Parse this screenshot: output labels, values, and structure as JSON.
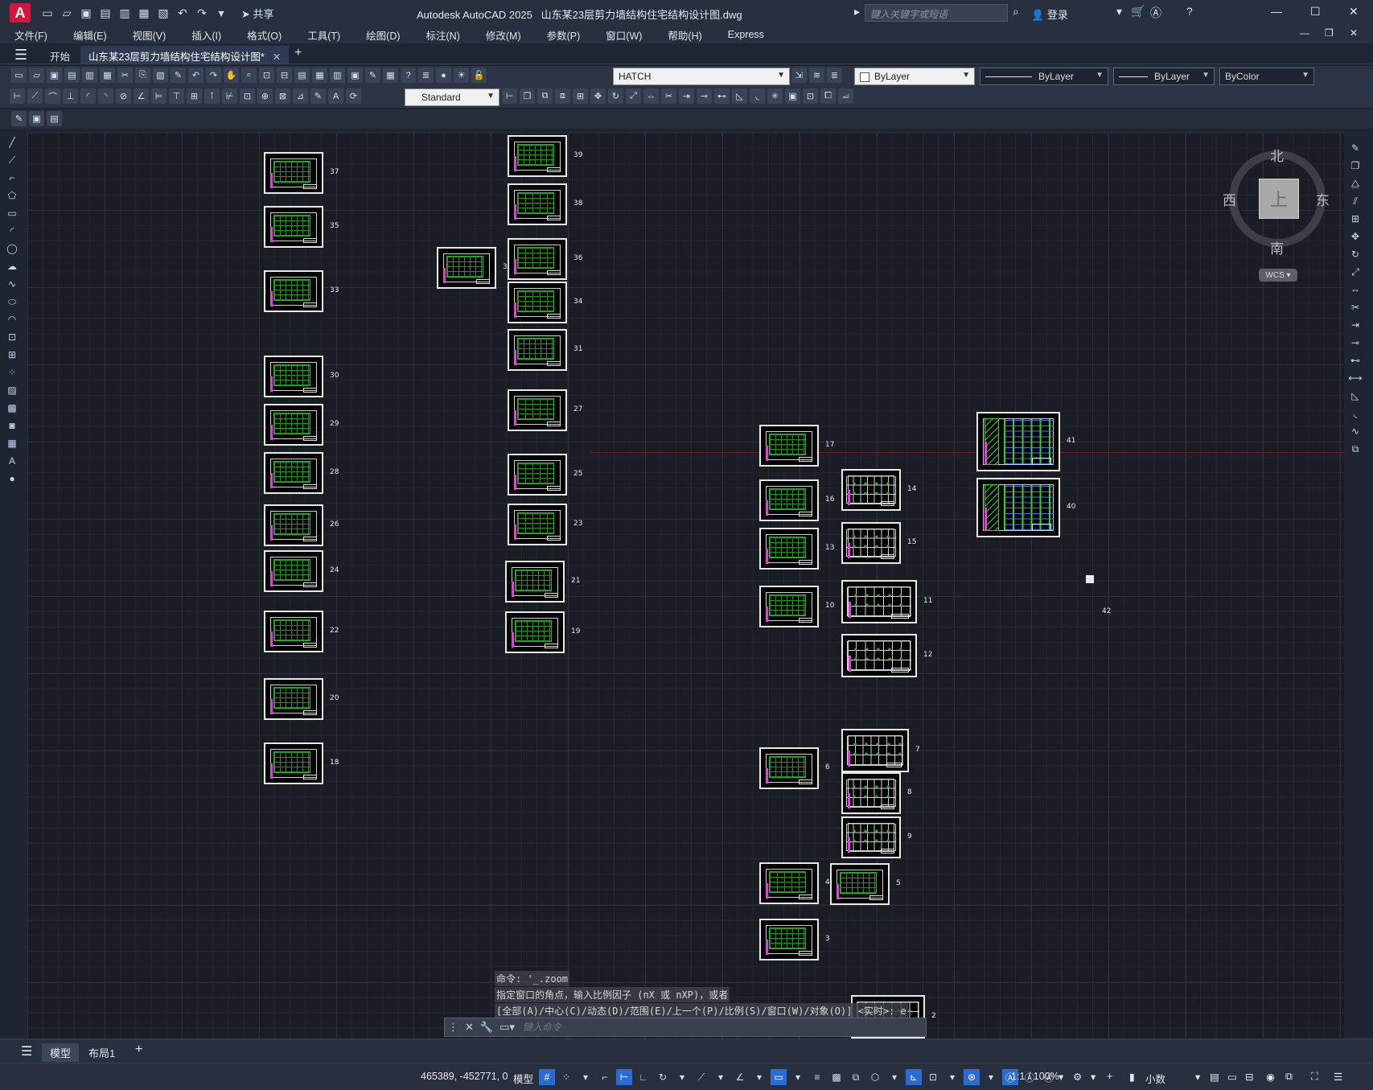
{
  "titlebar": {
    "app_name": "Autodesk AutoCAD 2025",
    "file_name": "山东某23层剪力墙结构住宅结构设计图.dwg",
    "share_label": "共享",
    "search_placeholder": "键入关键字或短语",
    "login_label": "登录"
  },
  "menu": [
    "文件(F)",
    "编辑(E)",
    "视图(V)",
    "插入(I)",
    "格式(O)",
    "工具(T)",
    "绘图(D)",
    "标注(N)",
    "修改(M)",
    "参数(P)",
    "窗口(W)",
    "帮助(H)",
    "Express"
  ],
  "tabs": {
    "start": "开始",
    "active": "山东某23层剪力墙结构住宅结构设计图*"
  },
  "toolbar": {
    "hatch_label": "HATCH",
    "layer_color": "ByLayer",
    "linetype": "ByLayer",
    "lineweight": "ByLayer",
    "plotstyle": "ByColor",
    "text_style": "Standard"
  },
  "viewcube": {
    "north": "北",
    "south": "南",
    "east": "东",
    "west": "西",
    "face": "上",
    "wcs": "WCS"
  },
  "sheets": [
    {
      "label": "37"
    },
    {
      "label": "35"
    },
    {
      "label": "33"
    },
    {
      "label": "30"
    },
    {
      "label": "29"
    },
    {
      "label": "28"
    },
    {
      "label": "26"
    },
    {
      "label": "24"
    },
    {
      "label": "22"
    },
    {
      "label": "20"
    },
    {
      "label": "18"
    },
    {
      "label": "32"
    },
    {
      "label": "39"
    },
    {
      "label": "38"
    },
    {
      "label": "36"
    },
    {
      "label": "34"
    },
    {
      "label": "31"
    },
    {
      "label": "27"
    },
    {
      "label": "25"
    },
    {
      "label": "23"
    },
    {
      "label": "21"
    },
    {
      "label": "19"
    },
    {
      "label": "17"
    },
    {
      "label": "16"
    },
    {
      "label": "13"
    },
    {
      "label": "10"
    },
    {
      "label": "6"
    },
    {
      "label": "4"
    },
    {
      "label": "3"
    },
    {
      "label": "14"
    },
    {
      "label": "15"
    },
    {
      "label": "11"
    },
    {
      "label": "12"
    },
    {
      "label": "7"
    },
    {
      "label": "8"
    },
    {
      "label": "9"
    },
    {
      "label": "5"
    },
    {
      "label": "2"
    },
    {
      "label": "41"
    },
    {
      "label": "40"
    },
    {
      "label": "42"
    }
  ],
  "command": {
    "history": [
      "命令: '_.zoom",
      "指定窗口的角点，输入比例因子 (nX 或 nXP)，或者",
      "[全部(A)/中心(C)/动态(D)/范围(E)/上一个(P)/比例(S)/窗口(W)/对象(O)] <实时>: e"
    ],
    "placeholder": "键入命令"
  },
  "layout_tabs": {
    "model": "模型",
    "layout1": "布局1"
  },
  "status": {
    "coords": "465389, -452771, 0",
    "space": "模型",
    "scale": "1:1 / 100%",
    "units": "小数"
  }
}
